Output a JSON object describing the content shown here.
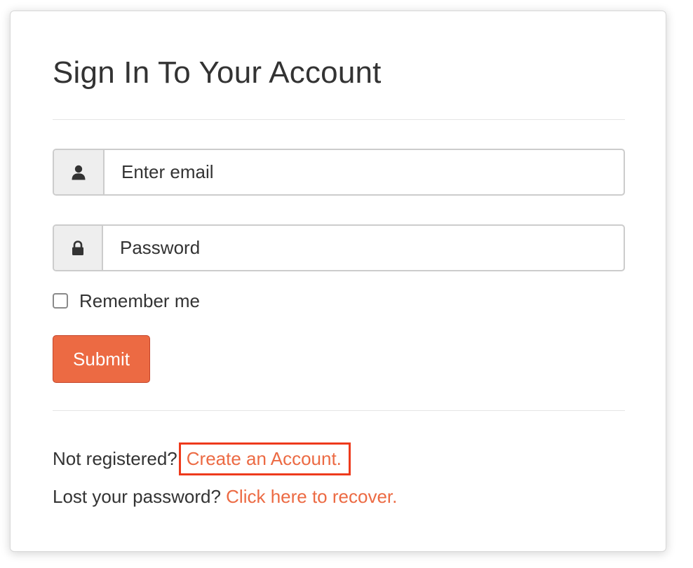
{
  "form": {
    "title": "Sign In To Your Account",
    "email": {
      "placeholder": "Enter email",
      "icon": "user-icon"
    },
    "password": {
      "placeholder": "Password",
      "icon": "lock-icon"
    },
    "remember": {
      "label": "Remember me",
      "checked": false
    },
    "submit_label": "Submit"
  },
  "footer": {
    "register": {
      "prompt": "Not registered?",
      "link_text": "Create an Account."
    },
    "recover": {
      "prompt": "Lost your password?",
      "link_text": "Click here to recover."
    }
  },
  "colors": {
    "accent": "#ec6a43",
    "highlight_border": "#ee3a1c",
    "text": "#333333",
    "addon_bg": "#eeeeee"
  }
}
